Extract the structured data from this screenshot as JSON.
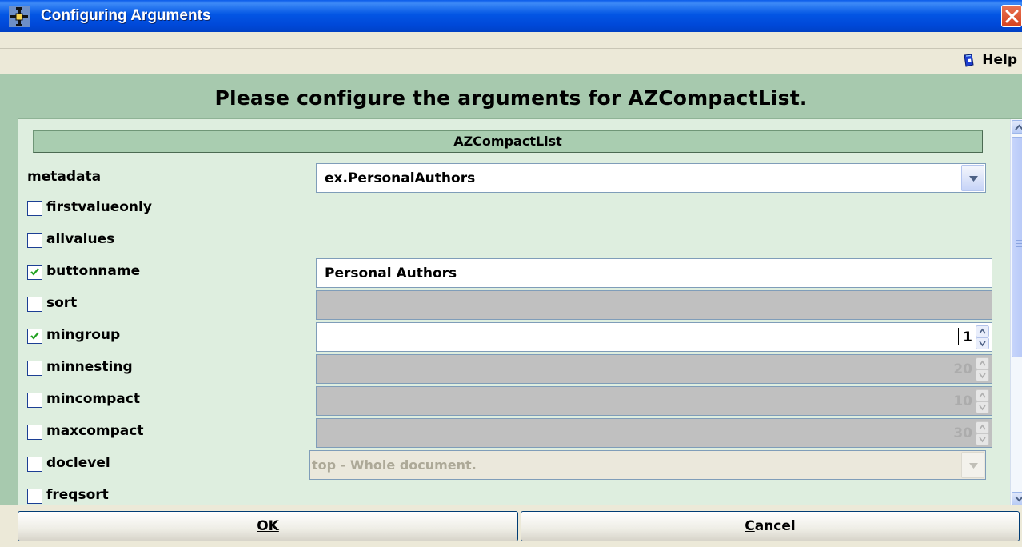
{
  "window": {
    "title": "Configuring Arguments"
  },
  "menu": {
    "help_label": "Help"
  },
  "prompt": "Please configure the arguments for AZCompactList.",
  "section": {
    "title": "AZCompactList"
  },
  "args": {
    "metadata": {
      "label": "metadata",
      "value": "ex.PersonalAuthors"
    },
    "firstvalueonly": {
      "label": "firstvalueonly",
      "checked": false
    },
    "allvalues": {
      "label": "allvalues",
      "checked": false
    },
    "buttonname": {
      "label": "buttonname",
      "checked": true,
      "value": "Personal Authors"
    },
    "sort": {
      "label": "sort",
      "checked": false,
      "value": ""
    },
    "mingroup": {
      "label": "mingroup",
      "checked": true,
      "value": "1"
    },
    "minnesting": {
      "label": "minnesting",
      "checked": false,
      "value": "20"
    },
    "mincompact": {
      "label": "mincompact",
      "checked": false,
      "value": "10"
    },
    "maxcompact": {
      "label": "maxcompact",
      "checked": false,
      "value": "30"
    },
    "doclevel": {
      "label": "doclevel",
      "checked": false,
      "value": "top - Whole document."
    },
    "freqsort": {
      "label": "freqsort",
      "checked": false
    }
  },
  "buttons": {
    "ok_label": "OK",
    "cancel_label": "Cancel"
  },
  "colors": {
    "titlebar": "#0356e4",
    "outer_bg": "#a7c9ae",
    "panel_bg": "#deeedf",
    "disabled_field": "#c0c0c0"
  }
}
